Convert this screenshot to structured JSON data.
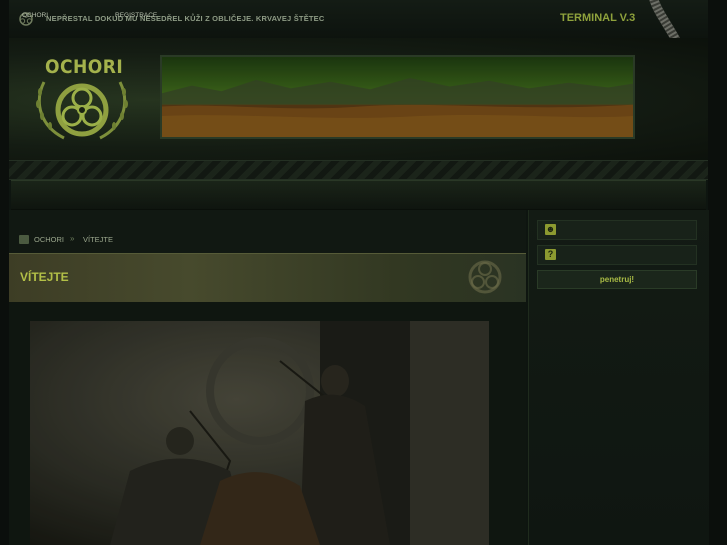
{
  "topbar": {
    "tagline": "NEPŘESTAL DOKUD MU NESEDŘEL KŮŽI Z OBLIČEJE. KRVAVEJ ŠTĚTEC",
    "version": "TERMINAL V.3"
  },
  "header": {
    "brand": "OCHORI"
  },
  "nav": {
    "items": [
      {
        "label": "OCHORI"
      },
      {
        "label": "REGISTRACE"
      }
    ]
  },
  "breadcrumb": {
    "home": "OCHORI",
    "separator": "»",
    "current": "VÍTEJTE"
  },
  "page": {
    "title": "VÍTEJTE"
  },
  "login": {
    "username_icon": "user-icon",
    "password_icon": "question-icon",
    "username_value": "",
    "password_value": "",
    "submit_label": "penetruj!"
  },
  "colors": {
    "accent": "#a9bb45",
    "background": "#0e1510",
    "title_bar": "#474a2d"
  }
}
